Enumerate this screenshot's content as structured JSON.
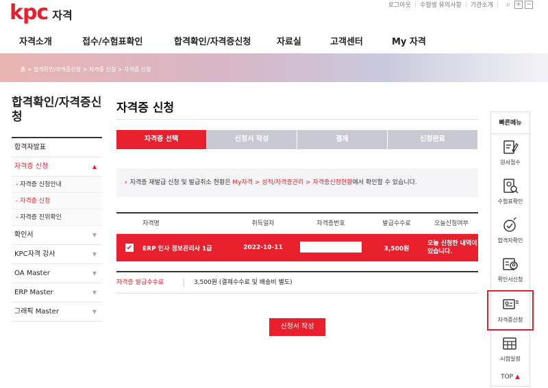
{
  "header": {
    "logo_mark": "kpc",
    "logo_text": "자격",
    "util_links": [
      "로그아웃",
      "수험생 유의사항",
      "기관소개"
    ]
  },
  "gnb": [
    "자격소개",
    "접수/수험표확인",
    "합격확인/자격증신청",
    "자료실",
    "고객센터",
    "My 자격"
  ],
  "breadcrumb": "홈 > 합격확인/자격증신청 > 자격증 신청 > 자격증 신청",
  "sidebar": {
    "title": "합격확인/자격증신청",
    "items": [
      {
        "label": "합격자발표"
      },
      {
        "label": "자격증 신청"
      },
      {
        "label": "- 자격증 신청안내"
      },
      {
        "label": "- 자격증 신청"
      },
      {
        "label": "- 자격증 진위확인"
      },
      {
        "label": "확인서"
      },
      {
        "label": "KPC자격 강사"
      },
      {
        "label": "OA Master"
      },
      {
        "label": "ERP Master"
      },
      {
        "label": "그래픽 Master"
      }
    ]
  },
  "main": {
    "title": "자격증 신청",
    "steps": [
      "자격증 선택",
      "신청서 작성",
      "결제",
      "신청완료"
    ],
    "notice": {
      "prefix": "자격증 재발급 신청 및 발급취소 현황은 ",
      "link": "My자격 > 성적/자격증관리 > 자격증신청현황",
      "suffix": "에서 확인할 수 있습니다."
    },
    "table": {
      "headers": [
        "자격명",
        "취득일자",
        "자격증번호",
        "발급수수료",
        "오늘신청여부"
      ],
      "row": {
        "name": "ERP 인사 정보관리사 1급",
        "date": "2022-10-11",
        "fee": "3,500원",
        "today": "오늘 신청한 내역이 있습니다."
      }
    },
    "fee_label": "자격증 발급수수료",
    "fee_value": "3,500원 (결제수수료 및 배송비 별도)",
    "submit_label": "신청서 작성"
  },
  "quick_menu": {
    "title": "빠른메뉴",
    "items": [
      "원서접수",
      "수험표확인",
      "합격자확인",
      "확인서신청",
      "자격증신청",
      "시험일정"
    ],
    "top": "TOP"
  },
  "colors": {
    "accent": "#e8202e",
    "step_inactive": "#c9c9d3"
  }
}
